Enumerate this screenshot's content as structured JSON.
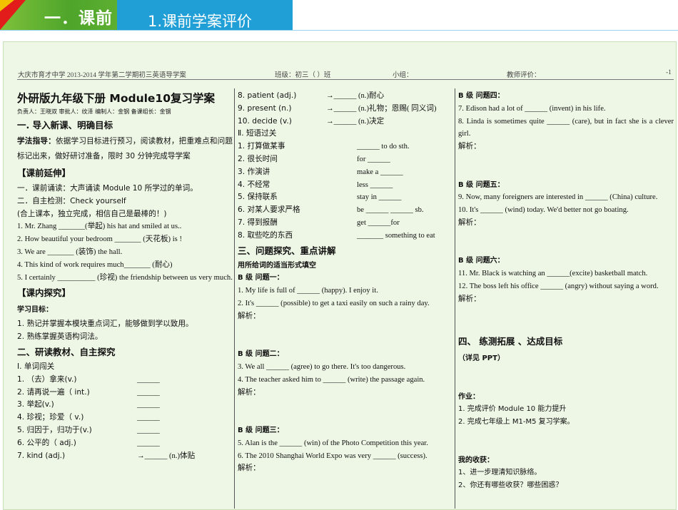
{
  "slide": {
    "section_label": "一．课前",
    "subtitle": "1.课前学案评价"
  },
  "doc_header": {
    "school": "大庆市育才中学 2013-2014 学年第二学期初三英语导学案",
    "class_field": "班级：初三（  ）班",
    "group_field": "小组：",
    "teacher_eval": "教师评价：",
    "page": "-1"
  },
  "col1": {
    "title": "外研版九年级下册 Module10复习学案",
    "staff": "负责人：王晓双    审批人：纹泽    编制人：金钢    备课组长：金钢",
    "s1": "一. 导入新课、明确目标",
    "method_label": "学法指导：",
    "method_text": "依据学习目标进行预习，阅读教材，把重难点和问题标记出来，做好研讨准备，限时 30 分钟完成导学案",
    "ext_head": "【课前延伸】",
    "ext1": "一．课前诵读：大声诵读 Module 10  所学过的单词。",
    "ext2": "二．自主检测：Check yourself",
    "ext3": "(合上课本，独立完成，相信自己是最棒的！)",
    "q1": "1. Mr. Zhang _______(举起) his hat and smiled at us..",
    "q2": "2. How beautiful your bedroom _______ (天花板) is !",
    "q3": "3. We are _______ (装饰) the hall.",
    "q4": "4. This kind of work requires much_______ (耐心)",
    "q5": "5. I certainly __________ (珍视) the friendship between us very much.",
    "in_head": "【课内探究】",
    "goal_head": "学习目标：",
    "goal1": "1. 熟记并掌握本模块重点词汇，能够做到学以致用。",
    "goal2": "2. 熟练掌握英语构词法。",
    "s2": "二、研读教材、自主探究",
    "vocab_head": "Ⅰ. 单词闯关",
    "vocab": [
      {
        "left": "1. （去）拿来(v.)",
        "right": "______"
      },
      {
        "left": "2. 请再说一遍（ int.)",
        "right": "______"
      },
      {
        "left": "3. 举起(v.)",
        "right": "______"
      },
      {
        "left": "4. 珍视；珍爱（ v.)",
        "right": "______"
      },
      {
        "left": "5. 归因于，归功于(v.)",
        "right": "______"
      },
      {
        "left": "6. 公平的（ adj.)",
        "right": "______"
      },
      {
        "left": "7. kind (adj.)",
        "right": "→______ (n.)体贴"
      }
    ]
  },
  "col2": {
    "words": [
      {
        "left": "8. patient (adj.)",
        "right": "→______ (n.)耐心"
      },
      {
        "left": "9. present (n.)",
        "right": "→______ (n.)礼物；恩赐( 同义词)"
      },
      {
        "left": "10. decide (v.)",
        "right": "→______ (n.)决定"
      }
    ],
    "phr_head": "Ⅱ. 短语过关",
    "phrases": [
      {
        "left": "1. 打算做某事",
        "right": "______ to do sth."
      },
      {
        "left": "2. 很长时间",
        "right": "for ______"
      },
      {
        "left": "3. 作演讲",
        "right": "make a ______"
      },
      {
        "left": "4. 不经常",
        "right": "less ______"
      },
      {
        "left": "5. 保持联系",
        "right": "stay in ______"
      },
      {
        "left": "6. 对某人要求严格",
        "right": "be ______ ______  sb."
      },
      {
        "left": "7. 得到报酬",
        "right": "get ______for"
      },
      {
        "left": "8. 取些吃的东西",
        "right": "_______ something to eat"
      }
    ],
    "s3": "三、问题探究、重点讲解",
    "fill_head": "用所给词的适当形式填空",
    "b1": "B 级  问题一：",
    "b1q1": "1. My life is full of ______ (happy). I enjoy it.",
    "b1q2": "2. It's ______ (possible) to get a taxi easily on such a rainy day.",
    "analysis": "解析：",
    "b2": "B 级  问题二：",
    "b2q1": "3. We all ______ (agree) to go there. It's too dangerous.",
    "b2q2": "4. The teacher asked him to ______ (write) the passage again.",
    "b3": "B 级  问题三：",
    "b3q1": "5. Alan is the ______ (win) of the Photo Competition this year.",
    "b3q2": "6. The 2010 Shanghai World Expo was very ______ (success)."
  },
  "col3": {
    "b4": "B 级  问题四：",
    "b4q1": "7. Edison had a lot of ______ (invent) in his life.",
    "b4q2": "8. Linda is sometimes quite ______ (care), but in fact she is a clever girl.",
    "analysis": "解析：",
    "b5": "B 级  问题五：",
    "b5q1": "9. Now, many foreigners are interested in ______ (China) culture.",
    "b5q2": "10. It's ______ (wind) today. We'd better not go boating.",
    "b6": "B 级  问题六：",
    "b6q1": "11. Mr. Black is watching an ______(excite) basketball match.",
    "b6q2": "12. The boss left his office ______ (angry) without saying a word.",
    "s4": "四、 练测拓展 、达成目标",
    "see_ppt": "（详见 PPT）",
    "hw_head": "作业：",
    "hw1": "1. 完成评价 Module 10 能力提升",
    "hw2": "2. 完成七年级上 M1-M5 复习学案。",
    "gain_head": "我的收获：",
    "gain1": "1、进一步理清知识脉络。",
    "gain2": "2、你还有哪些收获？哪些困惑？"
  }
}
